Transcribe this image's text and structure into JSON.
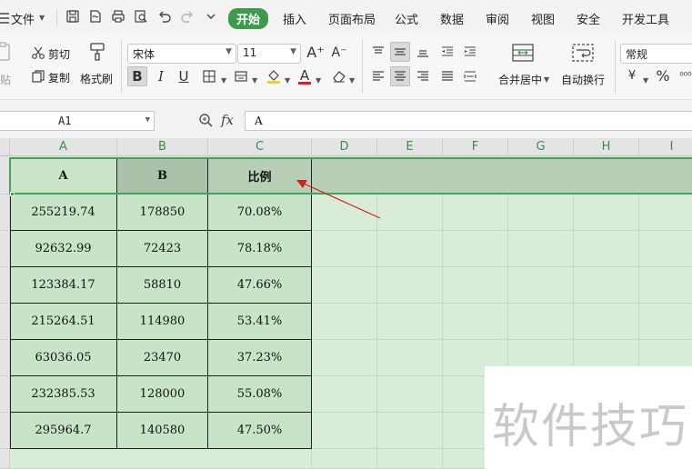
{
  "menu": {
    "file_label": "文件",
    "tabs": [
      "开始",
      "插入",
      "页面布局",
      "公式",
      "数据",
      "审阅",
      "视图",
      "安全",
      "开发工具"
    ],
    "active_tab": "开始"
  },
  "ribbon": {
    "paste_label": "粘贴",
    "cut_label": "剪切",
    "copy_label": "复制",
    "format_painter_label": "格式刷",
    "font_name": "宋体",
    "font_size": "11",
    "bold_label": "B",
    "italic_label": "I",
    "underline_label": "U",
    "increase_font_label": "A⁺",
    "decrease_font_label": "A⁻",
    "font_color_label": "A",
    "merge_center_label": "合并居中",
    "wrap_text_label": "自动换行",
    "number_format": "常规",
    "percent_label": "%",
    "accent_color": "#3d9c4c"
  },
  "formula_bar": {
    "name_box": "A1",
    "fx_label": "fx",
    "content": "A"
  },
  "columns": [
    "A",
    "B",
    "C",
    "D",
    "E",
    "F",
    "G",
    "H",
    "I"
  ],
  "table": {
    "headers": [
      "A",
      "B",
      "比例"
    ],
    "rows": [
      [
        "255219.74",
        "178850",
        "70.08%"
      ],
      [
        "92632.99",
        "72423",
        "78.18%"
      ],
      [
        "123384.17",
        "58810",
        "47.66%"
      ],
      [
        "215264.51",
        "114980",
        "53.41%"
      ],
      [
        "63036.05",
        "23470",
        "37.23%"
      ],
      [
        "232385.53",
        "128000",
        "55.08%"
      ],
      [
        "295964.7",
        "140580",
        "47.50%"
      ]
    ]
  },
  "watermark_text": "软件技巧"
}
